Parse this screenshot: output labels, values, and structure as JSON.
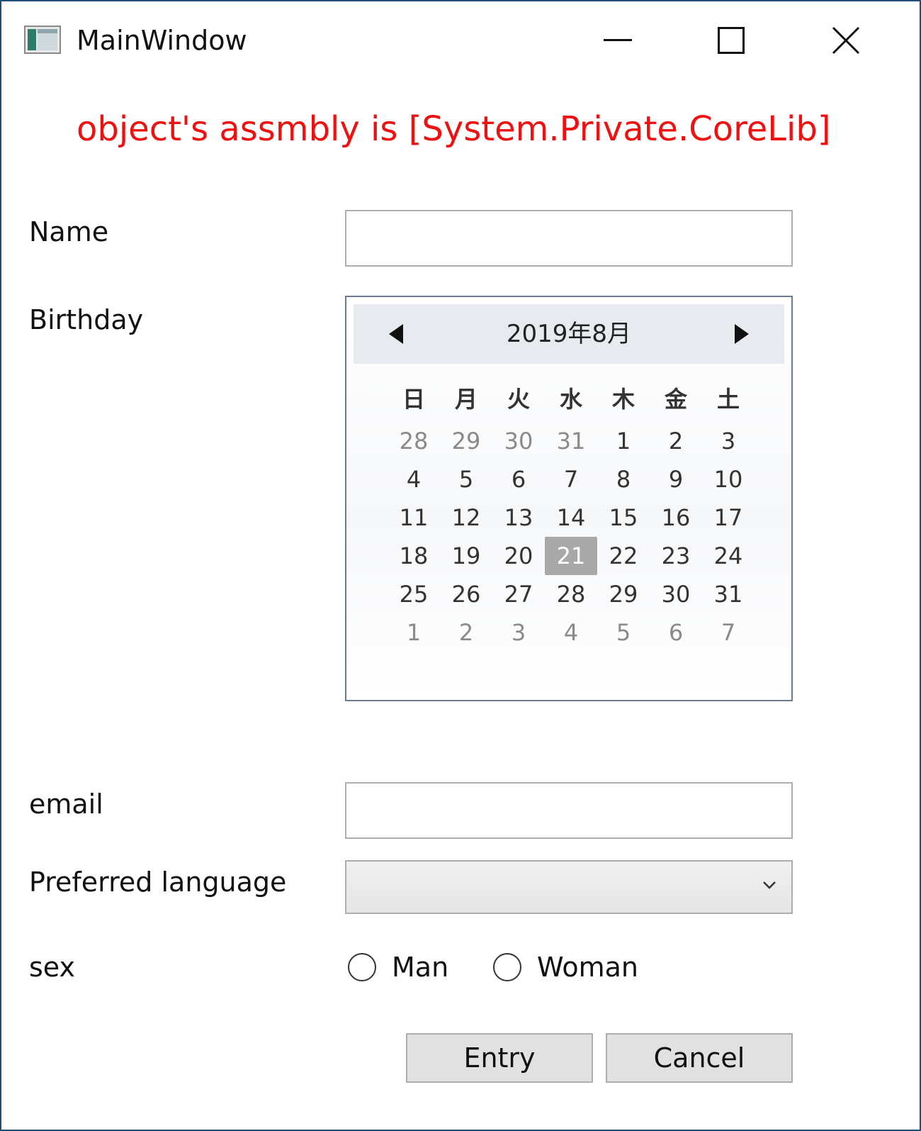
{
  "window": {
    "title": "MainWindow",
    "icons": {
      "app": "app-window-icon",
      "minimize": "minimize-icon",
      "maximize": "maximize-icon",
      "close": "close-icon"
    }
  },
  "assembly_message": "object's assmbly is [System.Private.CoreLib]",
  "form": {
    "name_label": "Name",
    "name_value": "",
    "birthday_label": "Birthday",
    "email_label": "email",
    "email_value": "",
    "language_label": "Preferred language",
    "language_selected": "",
    "sex_label": "sex",
    "sex_options": [
      "Man",
      "Woman"
    ],
    "entry_button": "Entry",
    "cancel_button": "Cancel"
  },
  "calendar": {
    "month_title": "2019年8月",
    "weekdays": [
      "日",
      "月",
      "火",
      "水",
      "木",
      "金",
      "土"
    ],
    "weeks": [
      [
        {
          "d": "28",
          "other": true
        },
        {
          "d": "29",
          "other": true
        },
        {
          "d": "30",
          "other": true
        },
        {
          "d": "31",
          "other": true
        },
        {
          "d": "1"
        },
        {
          "d": "2"
        },
        {
          "d": "3"
        }
      ],
      [
        {
          "d": "4"
        },
        {
          "d": "5"
        },
        {
          "d": "6"
        },
        {
          "d": "7"
        },
        {
          "d": "8"
        },
        {
          "d": "9"
        },
        {
          "d": "10"
        }
      ],
      [
        {
          "d": "11"
        },
        {
          "d": "12"
        },
        {
          "d": "13"
        },
        {
          "d": "14"
        },
        {
          "d": "15"
        },
        {
          "d": "16"
        },
        {
          "d": "17"
        }
      ],
      [
        {
          "d": "18"
        },
        {
          "d": "19"
        },
        {
          "d": "20"
        },
        {
          "d": "21",
          "selected": true
        },
        {
          "d": "22"
        },
        {
          "d": "23"
        },
        {
          "d": "24"
        }
      ],
      [
        {
          "d": "25"
        },
        {
          "d": "26"
        },
        {
          "d": "27"
        },
        {
          "d": "28"
        },
        {
          "d": "29"
        },
        {
          "d": "30"
        },
        {
          "d": "31"
        }
      ],
      [
        {
          "d": "1",
          "other": true
        },
        {
          "d": "2",
          "other": true
        },
        {
          "d": "3",
          "other": true
        },
        {
          "d": "4",
          "other": true
        },
        {
          "d": "5",
          "other": true
        },
        {
          "d": "6",
          "other": true
        },
        {
          "d": "7",
          "other": true
        }
      ]
    ]
  },
  "colors": {
    "assembly_text": "#ee1111",
    "window_border": "#1f4e79",
    "selected_day": "#a8a8a8"
  }
}
